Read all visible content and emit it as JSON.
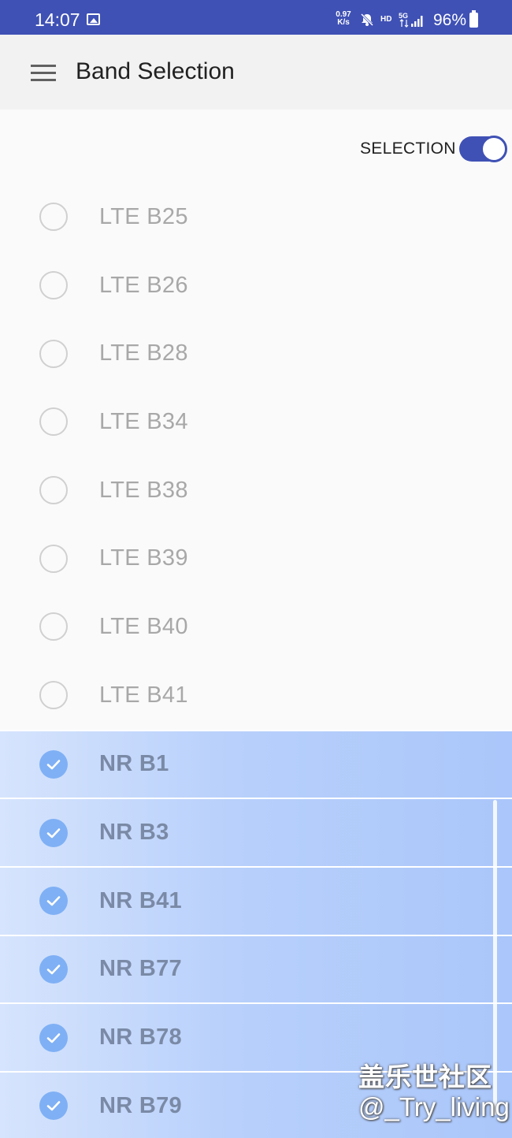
{
  "status_bar": {
    "time": "14:07",
    "speed_value": "0.97",
    "speed_unit": "K/s",
    "hd": "HD",
    "network": "5G",
    "battery": "96%",
    "icons": [
      "image-icon",
      "mute-icon",
      "signal-icon",
      "battery-icon"
    ]
  },
  "app_bar": {
    "title": "Band Selection",
    "menu_icon": "hamburger-menu-icon"
  },
  "selection": {
    "label": "SELECTION",
    "enabled": true
  },
  "colors": {
    "primary": "#3f51b5",
    "checked_row": "#b8d0fb",
    "checkbox": "#7fb0f5"
  },
  "bands": [
    {
      "label": "LTE B25",
      "checked": false
    },
    {
      "label": "LTE B26",
      "checked": false
    },
    {
      "label": "LTE B28",
      "checked": false
    },
    {
      "label": "LTE B34",
      "checked": false
    },
    {
      "label": "LTE B38",
      "checked": false
    },
    {
      "label": "LTE B39",
      "checked": false
    },
    {
      "label": "LTE B40",
      "checked": false
    },
    {
      "label": "LTE B41",
      "checked": false
    },
    {
      "label": "NR B1",
      "checked": true
    },
    {
      "label": "NR B3",
      "checked": true
    },
    {
      "label": "NR B41",
      "checked": true
    },
    {
      "label": "NR B77",
      "checked": true
    },
    {
      "label": "NR B78",
      "checked": true
    },
    {
      "label": "NR B79",
      "checked": true
    }
  ],
  "watermark": {
    "line1": "盖乐世社区",
    "line2": "@_Try_living"
  }
}
